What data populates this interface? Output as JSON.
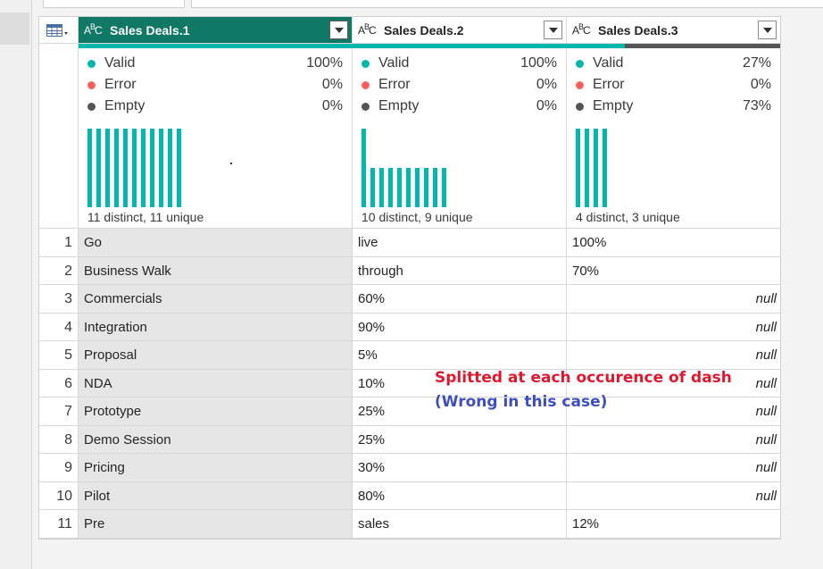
{
  "table": {
    "columns": [
      {
        "name": "Sales Deals.1",
        "type_icon": "ABC",
        "selected": true,
        "quality": [
          {
            "label": "Valid",
            "pct": "100%",
            "color": "#01b8aa"
          },
          {
            "label": "Error",
            "pct": "0%",
            "color": "#fd625e"
          },
          {
            "label": "Empty",
            "pct": "0%",
            "color": "#555555"
          }
        ],
        "quality_bar": {
          "valid": 1.0,
          "error": 0,
          "empty": 0
        },
        "histogram": [
          1,
          1,
          1,
          1,
          1,
          1,
          1,
          1,
          1,
          1,
          1
        ],
        "distinct": "11 distinct, 11 unique"
      },
      {
        "name": "Sales Deals.2",
        "type_icon": "ABC",
        "selected": false,
        "quality": [
          {
            "label": "Valid",
            "pct": "100%",
            "color": "#01b8aa"
          },
          {
            "label": "Error",
            "pct": "0%",
            "color": "#fd625e"
          },
          {
            "label": "Empty",
            "pct": "0%",
            "color": "#555555"
          }
        ],
        "quality_bar": {
          "valid": 1.0,
          "error": 0,
          "empty": 0
        },
        "histogram": [
          2,
          1,
          1,
          1,
          1,
          1,
          1,
          1,
          1,
          1
        ],
        "distinct": "10 distinct, 9 unique"
      },
      {
        "name": "Sales Deals.3",
        "type_icon": "ABC",
        "selected": false,
        "quality": [
          {
            "label": "Valid",
            "pct": "27%",
            "color": "#01b8aa"
          },
          {
            "label": "Error",
            "pct": "0%",
            "color": "#fd625e"
          },
          {
            "label": "Empty",
            "pct": "73%",
            "color": "#555555"
          }
        ],
        "quality_bar": {
          "valid": 0.27,
          "error": 0,
          "empty": 0.73
        },
        "histogram": [
          1,
          1,
          1,
          1
        ],
        "distinct": "4 distinct, 3 unique"
      }
    ],
    "rows": [
      {
        "idx": "1",
        "c1": "Go",
        "c2": "live",
        "c3": "100%"
      },
      {
        "idx": "2",
        "c1": "Business Walk",
        "c2": "through",
        "c3": "70%"
      },
      {
        "idx": "3",
        "c1": "Commercials",
        "c2": "60%",
        "c3": "null"
      },
      {
        "idx": "4",
        "c1": "Integration",
        "c2": "90%",
        "c3": "null"
      },
      {
        "idx": "5",
        "c1": "Proposal",
        "c2": "5%",
        "c3": "null"
      },
      {
        "idx": "6",
        "c1": "NDA",
        "c2": "10%",
        "c3": "null"
      },
      {
        "idx": "7",
        "c1": "Prototype",
        "c2": "25%",
        "c3": "null"
      },
      {
        "idx": "8",
        "c1": "Demo Session",
        "c2": "25%",
        "c3": "null"
      },
      {
        "idx": "9",
        "c1": "Pricing",
        "c2": "30%",
        "c3": "null"
      },
      {
        "idx": "10",
        "c1": "Pilot",
        "c2": "80%",
        "c3": "null"
      },
      {
        "idx": "11",
        "c1": "Pre",
        "c2": "sales",
        "c3": "12%"
      }
    ]
  },
  "annotation": {
    "line1": "Splitted at each occurence of dash",
    "line2": "(Wrong in this case)"
  },
  "colors": {
    "selected_header": "#117865",
    "valid": "#01b8aa",
    "error": "#fd625e",
    "empty": "#555555"
  }
}
